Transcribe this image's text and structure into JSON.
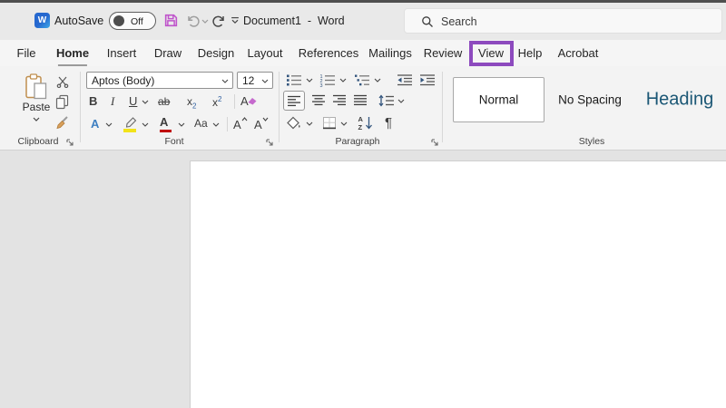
{
  "window": {
    "title": "Document1  -  Word"
  },
  "quick_access": {
    "autosave_label": "AutoSave",
    "autosave_state": "Off"
  },
  "search": {
    "placeholder": "Search"
  },
  "tabs": {
    "items": [
      {
        "label": "File"
      },
      {
        "label": "Home",
        "active": true
      },
      {
        "label": "Insert"
      },
      {
        "label": "Draw"
      },
      {
        "label": "Design"
      },
      {
        "label": "Layout"
      },
      {
        "label": "References"
      },
      {
        "label": "Mailings"
      },
      {
        "label": "Review"
      },
      {
        "label": "View",
        "highlighted": true
      },
      {
        "label": "Help"
      },
      {
        "label": "Acrobat"
      }
    ]
  },
  "ribbon": {
    "clipboard": {
      "group_label": "Clipboard",
      "paste_label": "Paste"
    },
    "font": {
      "group_label": "Font",
      "family": "Aptos (Body)",
      "size": "12",
      "glyphs": {
        "bold": "B",
        "italic": "I",
        "underline": "U",
        "strikethrough": "ab",
        "sub_base": "x",
        "sub_mark": "2",
        "sup_base": "x",
        "sup_mark": "2",
        "clear_format": "A",
        "text_effects": "A",
        "font_color": "A",
        "change_case": "Aa",
        "grow_font": "A",
        "shrink_font": "A"
      }
    },
    "paragraph": {
      "group_label": "Paragraph",
      "sort_a": "A",
      "sort_z": "Z",
      "pilcrow": "¶"
    },
    "styles": {
      "group_label": "Styles",
      "items": [
        {
          "label": "Normal",
          "selected": true
        },
        {
          "label": "No Spacing"
        },
        {
          "label": "Heading"
        }
      ]
    }
  },
  "colors": {
    "accent_purple": "#8d4abe",
    "save_icon_magenta": "#bf54cb",
    "heading_text_blue": "#1b5775",
    "highlight_yellow": "#f2e31a",
    "font_color_red": "#c00000",
    "titlebar_bg": "#e9e9e9",
    "ribbon_bg": "#f3f3f3"
  }
}
